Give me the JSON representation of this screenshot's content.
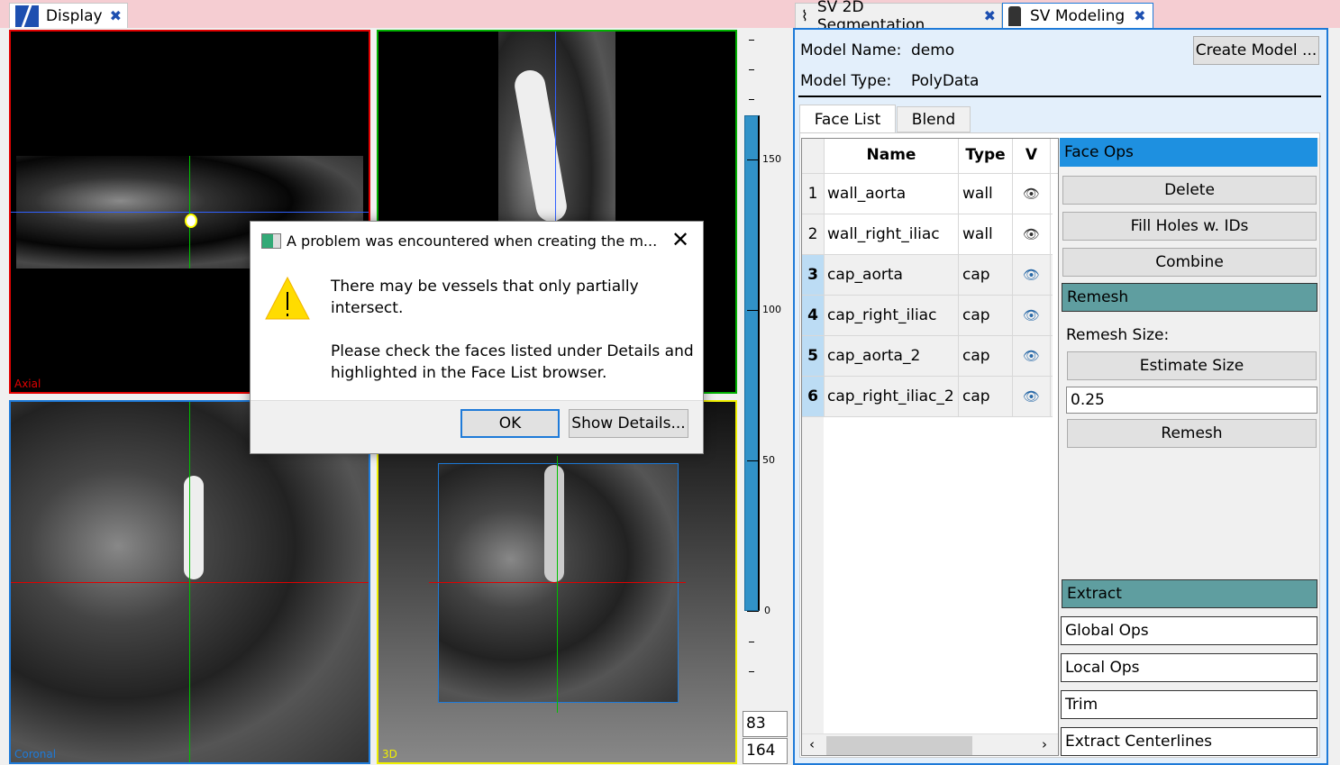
{
  "display_tab": {
    "label": "Display"
  },
  "viewports": {
    "axial": "Axial",
    "coronal": "Coronal",
    "three_d": "3D"
  },
  "level_slider": {
    "ticks": [
      "150",
      "100",
      "50",
      "0"
    ],
    "min": 0,
    "max": 164,
    "value_top": 164,
    "fill_color": "#3192c8",
    "lower": "83",
    "upper": "164"
  },
  "right_tabs": [
    {
      "label": "SV 2D Segmentation"
    },
    {
      "label": "SV Modeling"
    }
  ],
  "model": {
    "name_label": "Model Name:",
    "name": "demo",
    "type_label": "Model Type:",
    "type": "PolyData",
    "create_button": "Create Model ..."
  },
  "subtabs": [
    {
      "label": "Face List"
    },
    {
      "label": "Blend"
    }
  ],
  "face_table": {
    "headers": [
      "Name",
      "Type",
      "V"
    ],
    "rows": [
      {
        "id": "1",
        "name": "wall_aorta",
        "type": "wall",
        "visible": true,
        "highlighted": false
      },
      {
        "id": "2",
        "name": "wall_right_iliac",
        "type": "wall",
        "visible": true,
        "highlighted": false
      },
      {
        "id": "3",
        "name": "cap_aorta",
        "type": "cap",
        "visible": true,
        "highlighted": true
      },
      {
        "id": "4",
        "name": "cap_right_iliac",
        "type": "cap",
        "visible": true,
        "highlighted": true
      },
      {
        "id": "5",
        "name": "cap_aorta_2",
        "type": "cap",
        "visible": true,
        "highlighted": true
      },
      {
        "id": "6",
        "name": "cap_right_iliac_2",
        "type": "cap",
        "visible": true,
        "highlighted": true
      }
    ]
  },
  "ops": {
    "face_ops": "Face Ops",
    "delete": "Delete",
    "fill_holes": "Fill Holes w. IDs",
    "combine": "Combine",
    "remesh_header": "Remesh",
    "remesh_size_label": "Remesh Size:",
    "estimate_size": "Estimate Size",
    "remesh_size_value": "0.25",
    "remesh": "Remesh",
    "extract": "Extract",
    "global_ops": "Global Ops",
    "local_ops": "Local Ops",
    "trim": "Trim",
    "extract_centerlines": "Extract Centerlines"
  },
  "dialog": {
    "title": "A problem was encountered when creating the m...",
    "line1": "There may be vessels that only partially intersect.",
    "line2": "Please check the faces listed under Details and highlighted in the Face List browser.",
    "ok": "OK",
    "details": "Show Details...",
    "icon": "warning-icon"
  },
  "colors": {
    "accent": "#1e7ad8",
    "face_ops": "#1e90e0",
    "section": "#5f9ea0",
    "axial": "#e00000",
    "sagittal": "#00b000",
    "coronal": "#1e7ad8",
    "three_d": "#f0f000"
  }
}
